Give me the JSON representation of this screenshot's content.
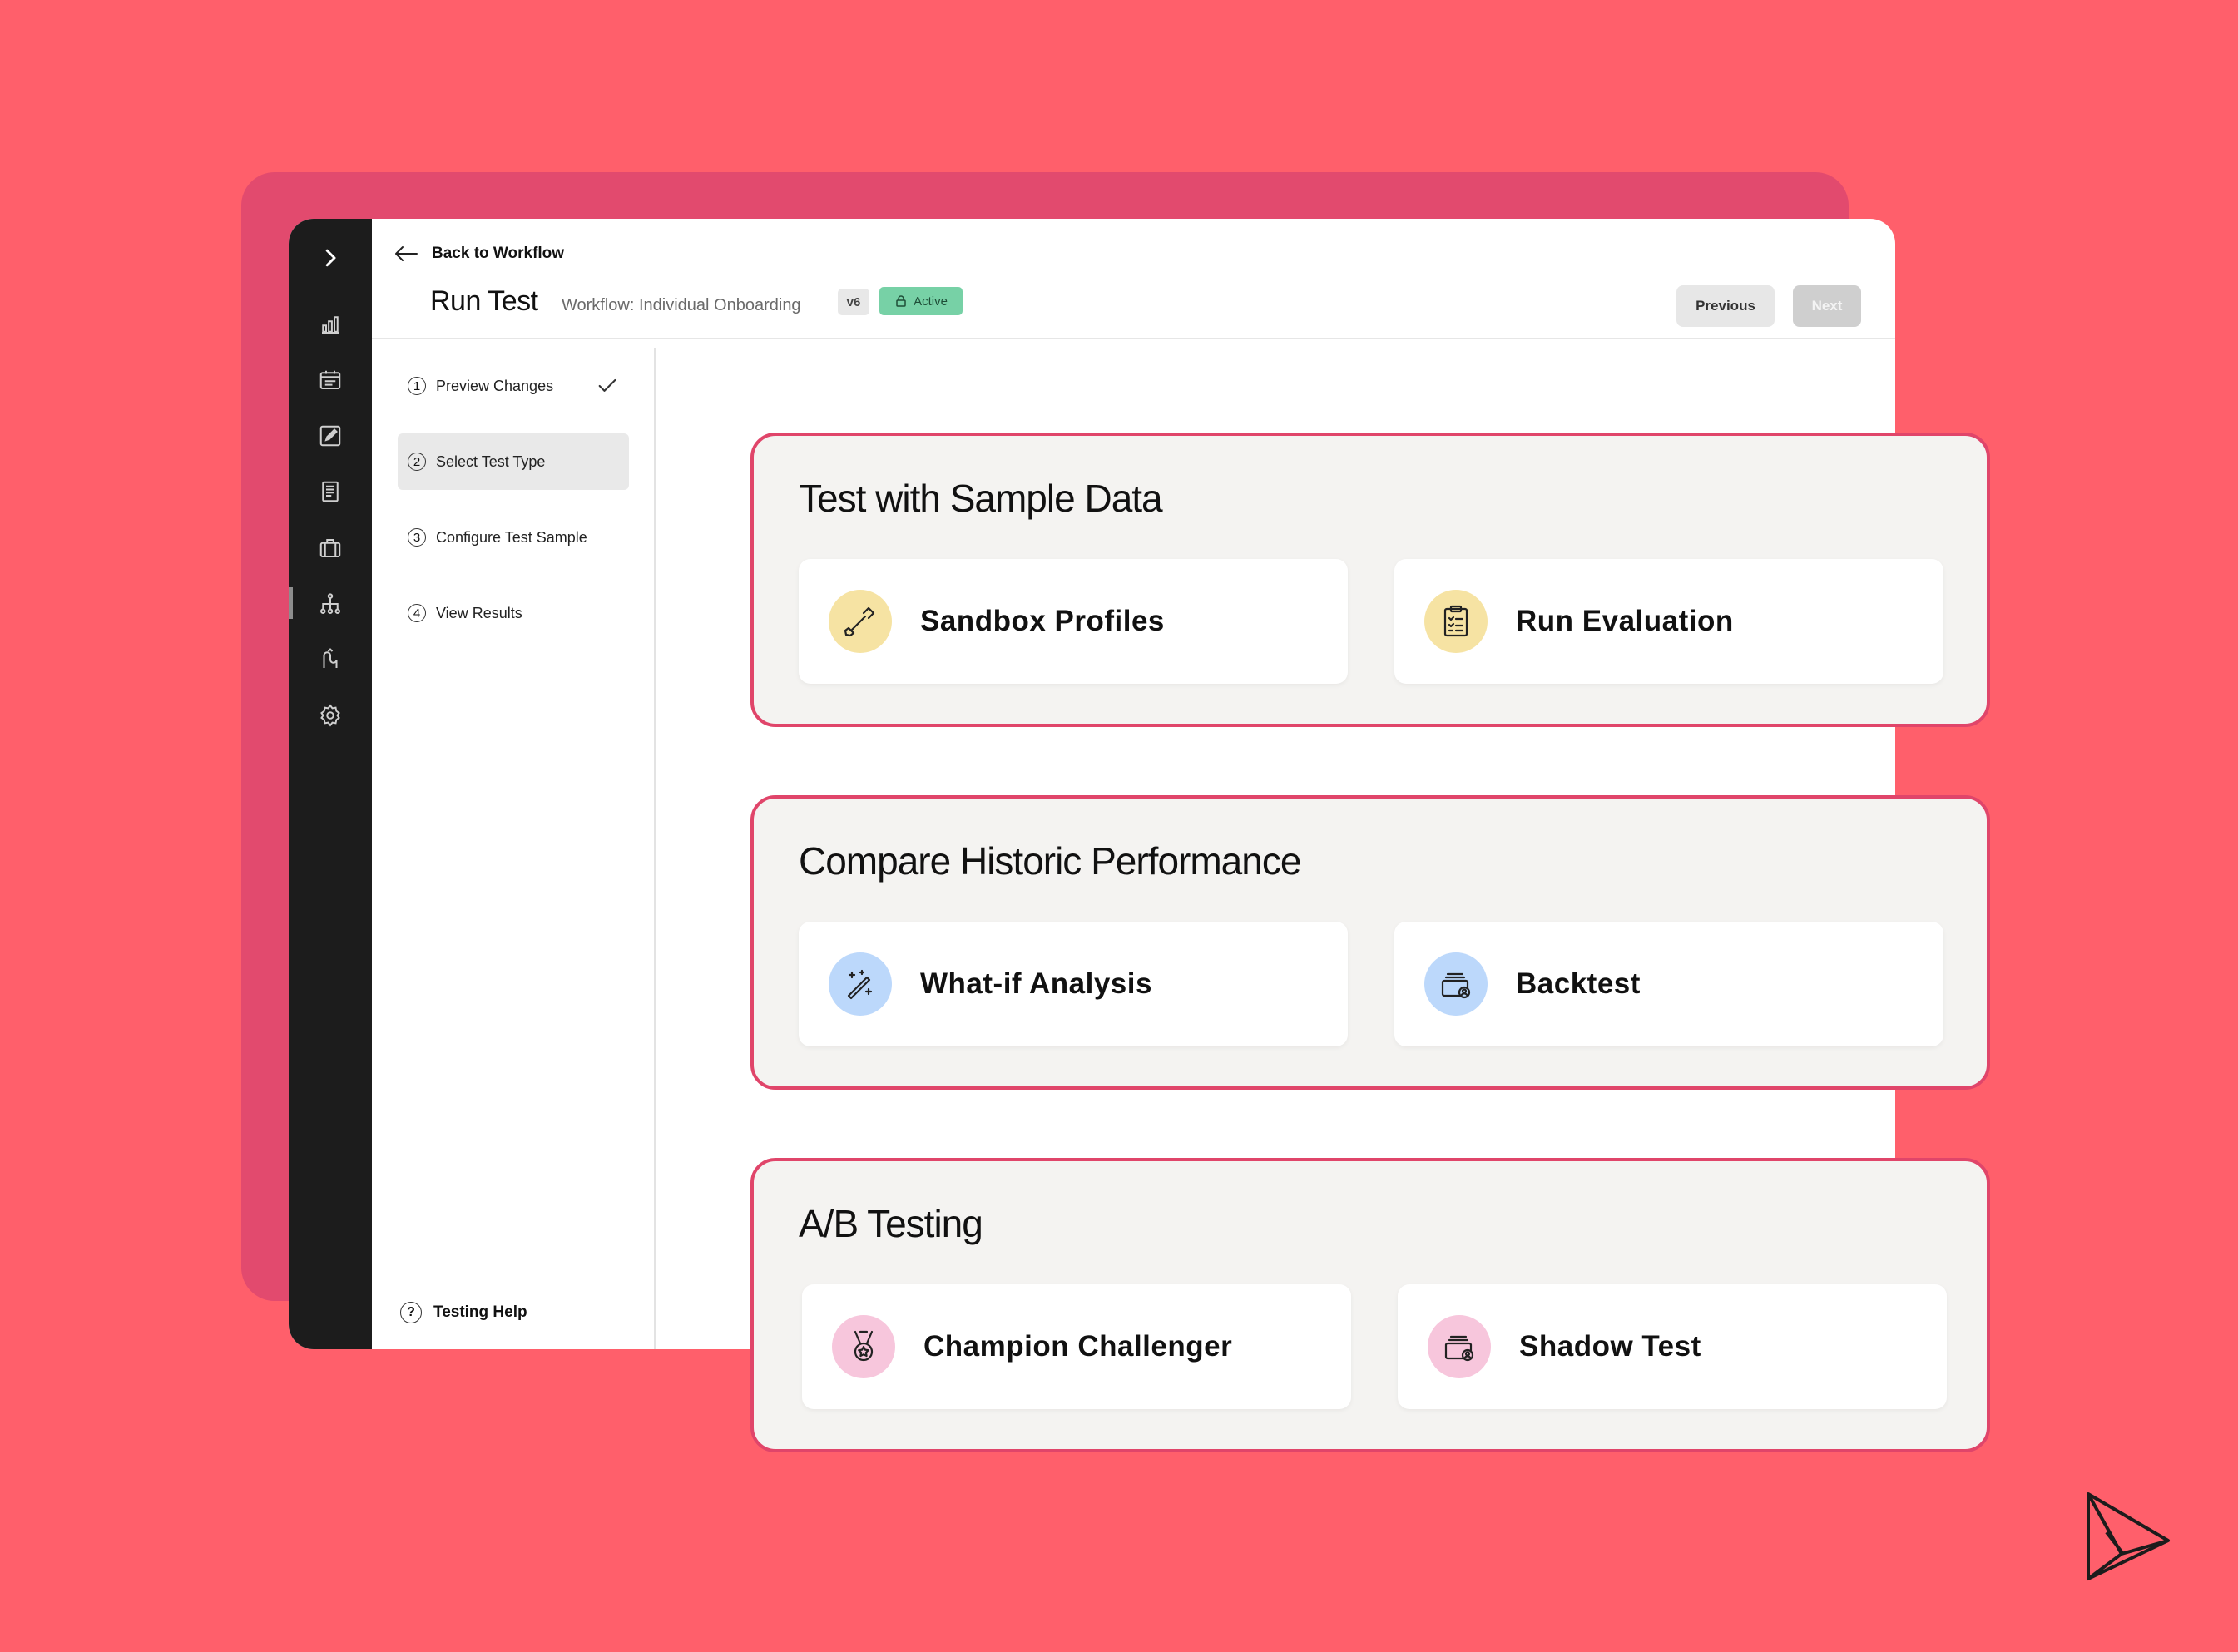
{
  "colors": {
    "background": "#ff5f6b",
    "accent": "#e0456a",
    "sidebar": "#1c1c1c",
    "status_active": "#77d1a6"
  },
  "sidebar": {
    "toggle_icon": "chevron-right-icon",
    "items": [
      {
        "icon": "bar-chart-icon"
      },
      {
        "icon": "list-icon"
      },
      {
        "icon": "edit-icon"
      },
      {
        "icon": "document-icon"
      },
      {
        "icon": "briefcase-icon"
      },
      {
        "icon": "hierarchy-icon",
        "active": true
      },
      {
        "icon": "branch-icon"
      },
      {
        "icon": "gear-icon"
      }
    ]
  },
  "header": {
    "back_label": "Back to Workflow",
    "title": "Run Test",
    "workflow_label": "Workflow: Individual Onboarding",
    "version": "v6",
    "status": "Active",
    "previous_label": "Previous",
    "next_label": "Next"
  },
  "steps": [
    {
      "number": "1",
      "label": "Preview Changes",
      "completed": true
    },
    {
      "number": "2",
      "label": "Select Test Type",
      "selected": true
    },
    {
      "number": "3",
      "label": "Configure Test Sample"
    },
    {
      "number": "4",
      "label": "View Results"
    }
  ],
  "help": {
    "icon": "question-icon",
    "label": "Testing Help"
  },
  "sections": [
    {
      "title": "Test with Sample Data",
      "options": [
        {
          "label": "Sandbox Profiles",
          "icon": "shovel-icon",
          "icon_bg": "yellow"
        },
        {
          "label": "Run Evaluation",
          "icon": "clipboard-checklist-icon",
          "icon_bg": "yellow"
        }
      ]
    },
    {
      "title": "Compare Historic Performance",
      "options": [
        {
          "label": "What-if Analysis",
          "icon": "magic-wand-icon",
          "icon_bg": "blue"
        },
        {
          "label": "Backtest",
          "icon": "profile-stack-icon",
          "icon_bg": "blue"
        }
      ]
    },
    {
      "title": "A/B Testing",
      "options": [
        {
          "label": "Champion Challenger",
          "icon": "medal-icon",
          "icon_bg": "pink"
        },
        {
          "label": "Shadow Test",
          "icon": "profile-stack-icon",
          "icon_bg": "pink"
        }
      ]
    }
  ]
}
